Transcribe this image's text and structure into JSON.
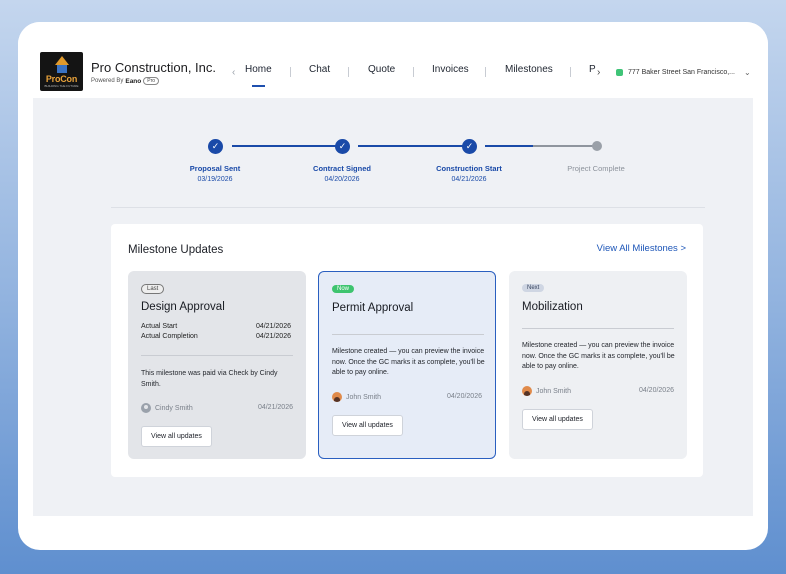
{
  "header": {
    "logo": {
      "brand": "ProCon",
      "tagline": "BUILDING THE FUTURE"
    },
    "company_name": "Pro Construction, Inc.",
    "powered_by": "Powered By",
    "powered_brand": "Eano",
    "plan_badge": "Pro",
    "nav_prev": "‹",
    "nav_next": "›",
    "tabs": [
      {
        "label": "Home",
        "active": true
      },
      {
        "label": "Chat",
        "active": false
      },
      {
        "label": "Quote",
        "active": false
      },
      {
        "label": "Invoices",
        "active": false
      },
      {
        "label": "Milestones",
        "active": false
      },
      {
        "label": "P",
        "active": false
      }
    ],
    "address": "777 Baker Street San Francisco,...",
    "address_chevron": "⌄"
  },
  "stepper": {
    "steps": [
      {
        "label": "Proposal Sent",
        "date": "03/19/2026",
        "done": true
      },
      {
        "label": "Contract Signed",
        "date": "04/20/2026",
        "done": true
      },
      {
        "label": "Construction Start",
        "date": "04/21/2026",
        "done": true
      },
      {
        "label": "Project Complete",
        "date": "",
        "done": false
      }
    ],
    "check": "✓"
  },
  "milestones": {
    "title": "Milestone Updates",
    "view_all": "View All Milestones >",
    "cards": [
      {
        "badge": "Last",
        "title": "Design Approval",
        "rows": [
          {
            "label": "Actual Start",
            "value": "04/21/2026"
          },
          {
            "label": "Actual Completion",
            "value": "04/21/2026"
          }
        ],
        "message": "This milestone was paid via Check by Cindy Smith.",
        "author": "Cindy Smith",
        "date": "04/21/2026",
        "button": "View all updates"
      },
      {
        "badge": "Now",
        "title": "Permit Approval",
        "message": "Milestone created — you can preview the invoice now. Once the GC marks it as complete, you'll be able to pay online.",
        "author": "John Smith",
        "date": "04/20/2026",
        "button": "View all updates"
      },
      {
        "badge": "Next",
        "title": "Mobilization",
        "message": "Milestone created — you can preview the invoice now. Once the GC marks it as complete, you'll be able to pay online.",
        "author": "John Smith",
        "date": "04/20/2026",
        "button": "View all updates"
      }
    ]
  },
  "colors": {
    "accent": "#1a4aa8",
    "now_badge": "#3ec46f",
    "location_dot": "#3fc477",
    "pending_step": "#9aa0a8"
  }
}
